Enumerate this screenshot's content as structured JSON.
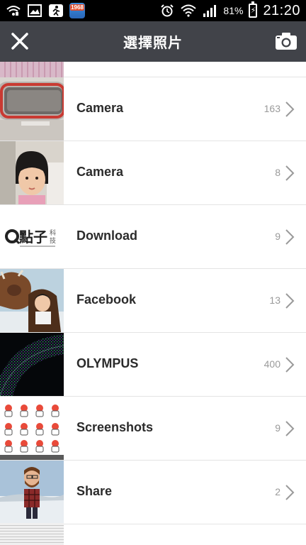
{
  "status_bar": {
    "badge_text": "1968",
    "battery_percent": "81%",
    "time": "21:20",
    "icons": [
      "wifi-call-icon",
      "image-icon",
      "runner-icon",
      "app-badge-icon",
      "alarm-icon",
      "wifi-icon",
      "signal-icon",
      "battery-charging-icon"
    ]
  },
  "header": {
    "title": "選擇照片",
    "background_color": "#414349",
    "left_icon": "close-icon",
    "right_icon": "camera-icon"
  },
  "albums": [
    {
      "name": "Camera",
      "count": "163",
      "thumbnail": "phone-bumper-photo"
    },
    {
      "name": "Camera",
      "count": "8",
      "thumbnail": "girl-portrait-photo"
    },
    {
      "name": "Download",
      "count": "9",
      "thumbnail": "dianzi-logo-image"
    },
    {
      "name": "Facebook",
      "count": "13",
      "thumbnail": "girl-with-cow-photo"
    },
    {
      "name": "OLYMPUS",
      "count": "400",
      "thumbnail": "dark-screen-macro-photo"
    },
    {
      "name": "Screenshots",
      "count": "9",
      "thumbnail": "sticker-grid-screenshot"
    },
    {
      "name": "Share",
      "count": "2",
      "thumbnail": "avatar-in-snow-image"
    }
  ],
  "thumb_text": {
    "download_logo_main": "點子",
    "download_logo_side1": "科",
    "download_logo_side2": "技"
  }
}
